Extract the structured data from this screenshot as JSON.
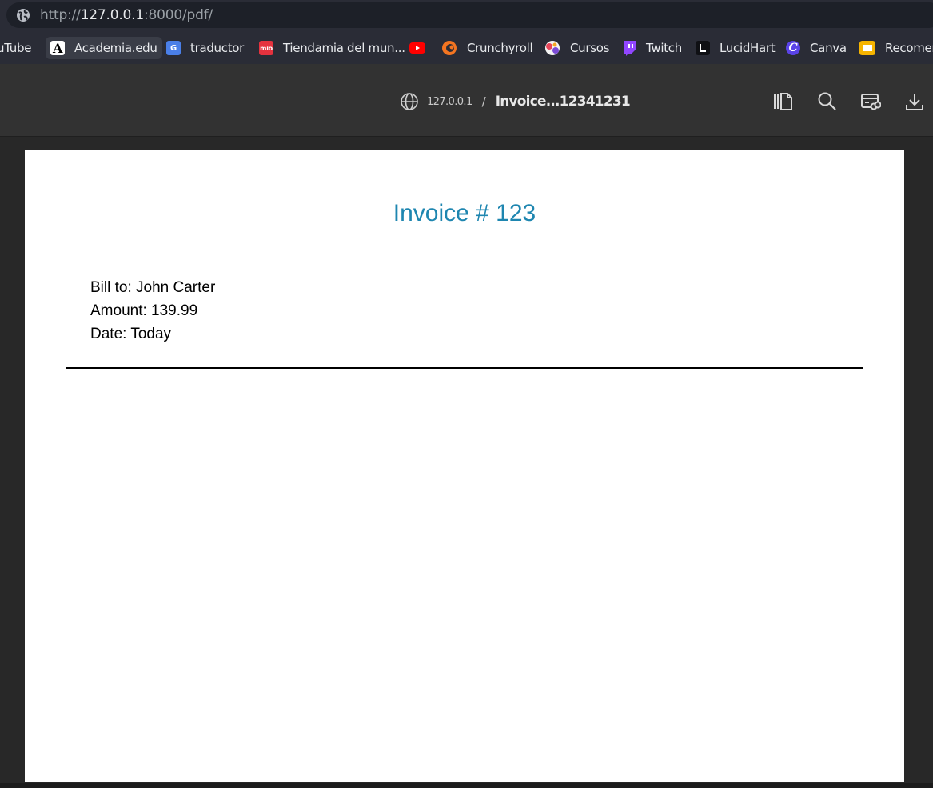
{
  "browser": {
    "address": {
      "scheme": "http://",
      "host": "127.0.0.1",
      "path": ":8000/pdf/"
    },
    "bookmarks": [
      {
        "label": "uTube",
        "icon": "youtube-icon"
      },
      {
        "label": "Academia.edu",
        "icon": "academia-icon",
        "glyph": "A"
      },
      {
        "label": "traductor",
        "icon": "translate-icon",
        "glyph": "G"
      },
      {
        "label": "Tiendamia del mun...",
        "icon": "tiendamia-icon",
        "glyph": "mio"
      },
      {
        "label": "",
        "icon": "youtube-icon"
      },
      {
        "label": "Crunchyroll",
        "icon": "crunchyroll-icon"
      },
      {
        "label": "Cursos",
        "icon": "cursos-icon"
      },
      {
        "label": "Twitch",
        "icon": "twitch-icon"
      },
      {
        "label": "LucidHart",
        "icon": "lucidhart-icon"
      },
      {
        "label": "Canva",
        "icon": "canva-icon",
        "glyph": "C"
      },
      {
        "label": "Recomen",
        "icon": "slides-icon"
      }
    ]
  },
  "pdf_viewer": {
    "host": "127.0.0.1",
    "separator": "/",
    "file_name": "Invoice...12341231",
    "tools": [
      "sidebar-icon",
      "search-icon",
      "link-card-icon",
      "download-icon"
    ]
  },
  "invoice": {
    "title": "Invoice # 123",
    "bill_to": "Bill to: John Carter",
    "amount": "Amount: 139.99",
    "date": "Date: Today"
  },
  "colors": {
    "title": "#1e86b0",
    "toolbar": "#323232",
    "bookmarks_bar": "#2a2c36"
  }
}
